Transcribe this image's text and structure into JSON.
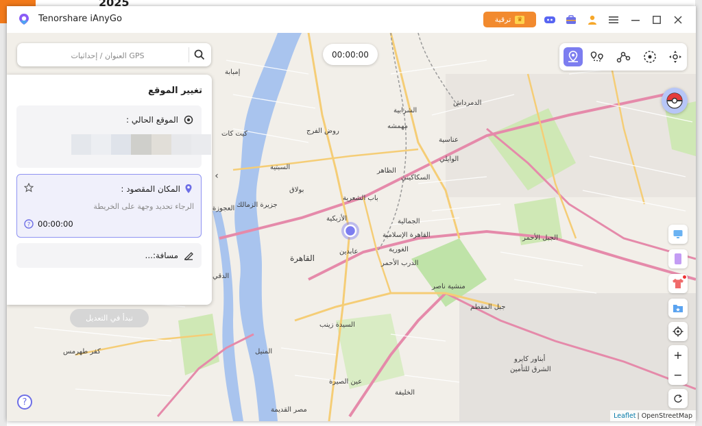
{
  "app": {
    "title": "Tenorshare iAnyGo",
    "upgrade_label": "ترقية"
  },
  "background": {
    "year": "2025"
  },
  "search": {
    "placeholder": "العنوان / إحداثيات GPS"
  },
  "timer": "00:00:00",
  "panel": {
    "title": "تغيير الموقع",
    "current_label": "الموقع الحالي :",
    "destination_label": "المكان المقصود :",
    "destination_placeholder": "الرجاء تحديد وجهة على الخريطة",
    "destination_time": "00:00:00",
    "distance_label": "مسافة:...",
    "start_button": "تبدأ في التعديل"
  },
  "map_labels": [
    "إمبابة",
    "روض الفرج",
    "الشرابية",
    "الدمرداش",
    "عناسية",
    "الوايلي",
    "الظاهر",
    "السكاكيني",
    "باب الشعرية",
    "الجمالية",
    "القاهرة الإسلامية",
    "الغورية",
    "الدرب الأحمر",
    "بولاق",
    "القاهرة",
    "عابدين",
    "الأزبكية",
    "السيدة زينب",
    "منشية ناصر",
    "جبل المقطم",
    "أبناور كايرو",
    "الشرق للتأمين",
    "المنيل",
    "عين الصيرة",
    "الخليفة",
    "مصر القديمة",
    "كفر طهرمس",
    "الدقي",
    "العجوزة",
    "جزيرة الزمالك",
    "كيت كات",
    "السبتية",
    "مهمشه",
    "الجبل الأحمر"
  ],
  "attribution": {
    "leaflet": "Leaflet",
    "osm": "| OpenStreetMap"
  },
  "colors": {
    "accent": "#7c7df0",
    "upgrade": "#f28a2e",
    "river": "#9fb8e8",
    "road_major": "#e07b9e",
    "road_secondary": "#f3c56b"
  }
}
